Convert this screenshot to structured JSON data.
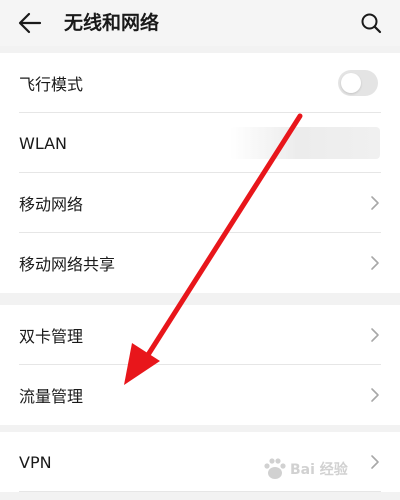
{
  "header": {
    "title": "无线和网络",
    "back_icon": "arrow-left-icon",
    "search_icon": "search-icon"
  },
  "groups": [
    {
      "rows": [
        {
          "label": "飞行模式",
          "control": "toggle",
          "toggle_on": false
        },
        {
          "label": "WLAN",
          "control": "value"
        },
        {
          "label": "移动网络",
          "control": "chevron"
        },
        {
          "label": "移动网络共享",
          "control": "chevron"
        }
      ]
    },
    {
      "rows": [
        {
          "label": "双卡管理",
          "control": "chevron"
        },
        {
          "label": "流量管理",
          "control": "chevron"
        }
      ]
    },
    {
      "rows": [
        {
          "label": "VPN",
          "control": "chevron"
        }
      ]
    }
  ],
  "annotation": {
    "color": "#e8161b",
    "icon": "red-arrow-annotation"
  },
  "watermark": {
    "text": "Bai 经验",
    "icon": "baidu-paw-icon"
  }
}
